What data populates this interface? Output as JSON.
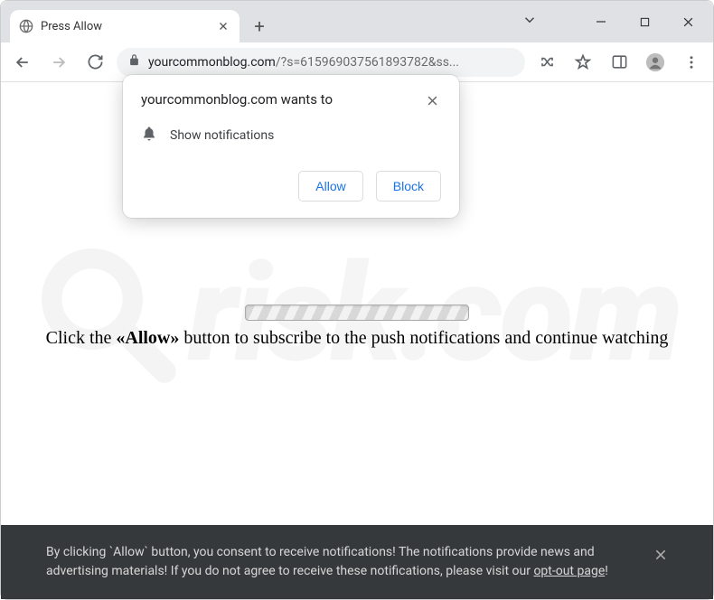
{
  "window": {
    "tab_title": "Press Allow",
    "url_domain": "yourcommonblog.com",
    "url_path": "/?s=615969037561893782&ss..."
  },
  "permission": {
    "prompt": "yourcommonblog.com wants to",
    "capability": "Show notifications",
    "allow": "Allow",
    "block": "Block"
  },
  "page": {
    "instruction_prefix": "Click the ",
    "instruction_bold": "«Allow»",
    "instruction_suffix": " button to subscribe to the push notifications and continue watching"
  },
  "consent": {
    "text_before": "By clicking `Allow` button, you consent to receive notifications! The notifications provide news and advertising materials! If you do not agree to receive these notifications, please visit our ",
    "link": "opt-out page",
    "text_after": "!"
  },
  "watermark": {
    "label": "risk.com"
  }
}
